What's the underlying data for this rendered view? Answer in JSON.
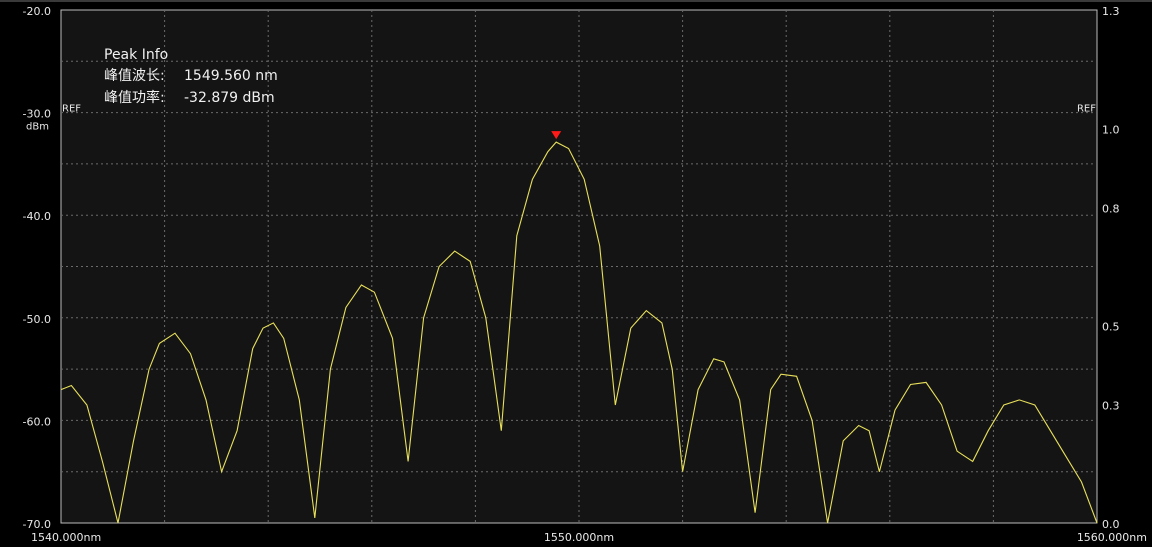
{
  "chart_data": {
    "type": "line",
    "title": "",
    "xlabel": "",
    "ylabel": "",
    "x_unit": "nm",
    "y_unit": "dBm",
    "xlim": [
      1540.0,
      1560.0
    ],
    "ylim": [
      -70.0,
      -20.0
    ],
    "y2lim": [
      0.0,
      1.3
    ],
    "grid": true,
    "x_tick_labels": [
      "1540.000nm",
      "1550.000nm",
      "1560.000nm"
    ],
    "y_ticks": [
      -20,
      -30,
      -40,
      -50,
      -60,
      -70
    ],
    "y_tick_labels": [
      "-20.0",
      "-30.0",
      "-40.0",
      "-50.0",
      "-60.0",
      "-70.0"
    ],
    "y2_ticks": [
      1.3,
      1.0,
      0.8,
      0.5,
      0.3,
      0.0
    ],
    "y2_tick_labels": [
      "1.3",
      "1.0",
      "0.8",
      "0.5",
      "0.3",
      "0.0"
    ],
    "ref_label": "REF",
    "ref_level": -30.0,
    "line_color": "#e8e05a",
    "marker_color": "#ff1a1a",
    "series": [
      {
        "x": [
          1540.0,
          1540.2,
          1540.5,
          1540.8,
          1541.1,
          1541.4,
          1541.7,
          1541.9,
          1542.2,
          1542.5,
          1542.8,
          1543.1,
          1543.4,
          1543.7,
          1543.9,
          1544.1,
          1544.3,
          1544.6,
          1544.9,
          1545.2,
          1545.5,
          1545.8,
          1546.05,
          1546.4,
          1546.7,
          1547.0,
          1547.3,
          1547.6,
          1547.9,
          1548.2,
          1548.5,
          1548.8,
          1549.1,
          1549.4,
          1549.56,
          1549.8,
          1550.1,
          1550.4,
          1550.7,
          1551.0,
          1551.3,
          1551.6,
          1551.8,
          1552.0,
          1552.3,
          1552.6,
          1552.8,
          1553.1,
          1553.4,
          1553.7,
          1553.9,
          1554.2,
          1554.5,
          1554.8,
          1555.1,
          1555.4,
          1555.6,
          1555.8,
          1556.1,
          1556.4,
          1556.7,
          1557.0,
          1557.3,
          1557.6,
          1557.9,
          1558.2,
          1558.5,
          1558.8,
          1559.1,
          1559.4,
          1559.7,
          1560.0
        ],
        "y": [
          -57.0,
          -56.6,
          -58.5,
          -64.0,
          -71.0,
          -62.0,
          -55.0,
          -52.5,
          -51.5,
          -53.5,
          -58.0,
          -65.0,
          -61.0,
          -53.0,
          -51.0,
          -50.5,
          -52.0,
          -58.0,
          -69.5,
          -55.0,
          -49.0,
          -46.8,
          -47.5,
          -52.0,
          -64.0,
          -50.0,
          -45.0,
          -43.5,
          -44.5,
          -50.0,
          -61.0,
          -42.0,
          -36.5,
          -33.8,
          -32.879,
          -33.5,
          -36.5,
          -43.0,
          -58.5,
          -51.0,
          -49.3,
          -50.5,
          -55.0,
          -65.0,
          -57.0,
          -54.0,
          -54.3,
          -58.0,
          -69.0,
          -57.0,
          -55.5,
          -55.7,
          -60.0,
          -71.0,
          -62.0,
          -60.5,
          -61.0,
          -65.0,
          -59.0,
          -56.5,
          -56.3,
          -58.5,
          -63.0,
          -64.0,
          -61.0,
          -58.5,
          -58.0,
          -58.5,
          -61.0,
          -63.5,
          -66.0,
          -70.0
        ]
      }
    ],
    "peak_marker": {
      "x": 1549.56,
      "y": -32.879
    },
    "peak_info": {
      "title": "Peak Info",
      "wavelength_label": "峰值波长:",
      "wavelength_value": "1549.560 nm",
      "power_label": "峰值功率:",
      "power_value": "-32.879 dBm"
    }
  }
}
